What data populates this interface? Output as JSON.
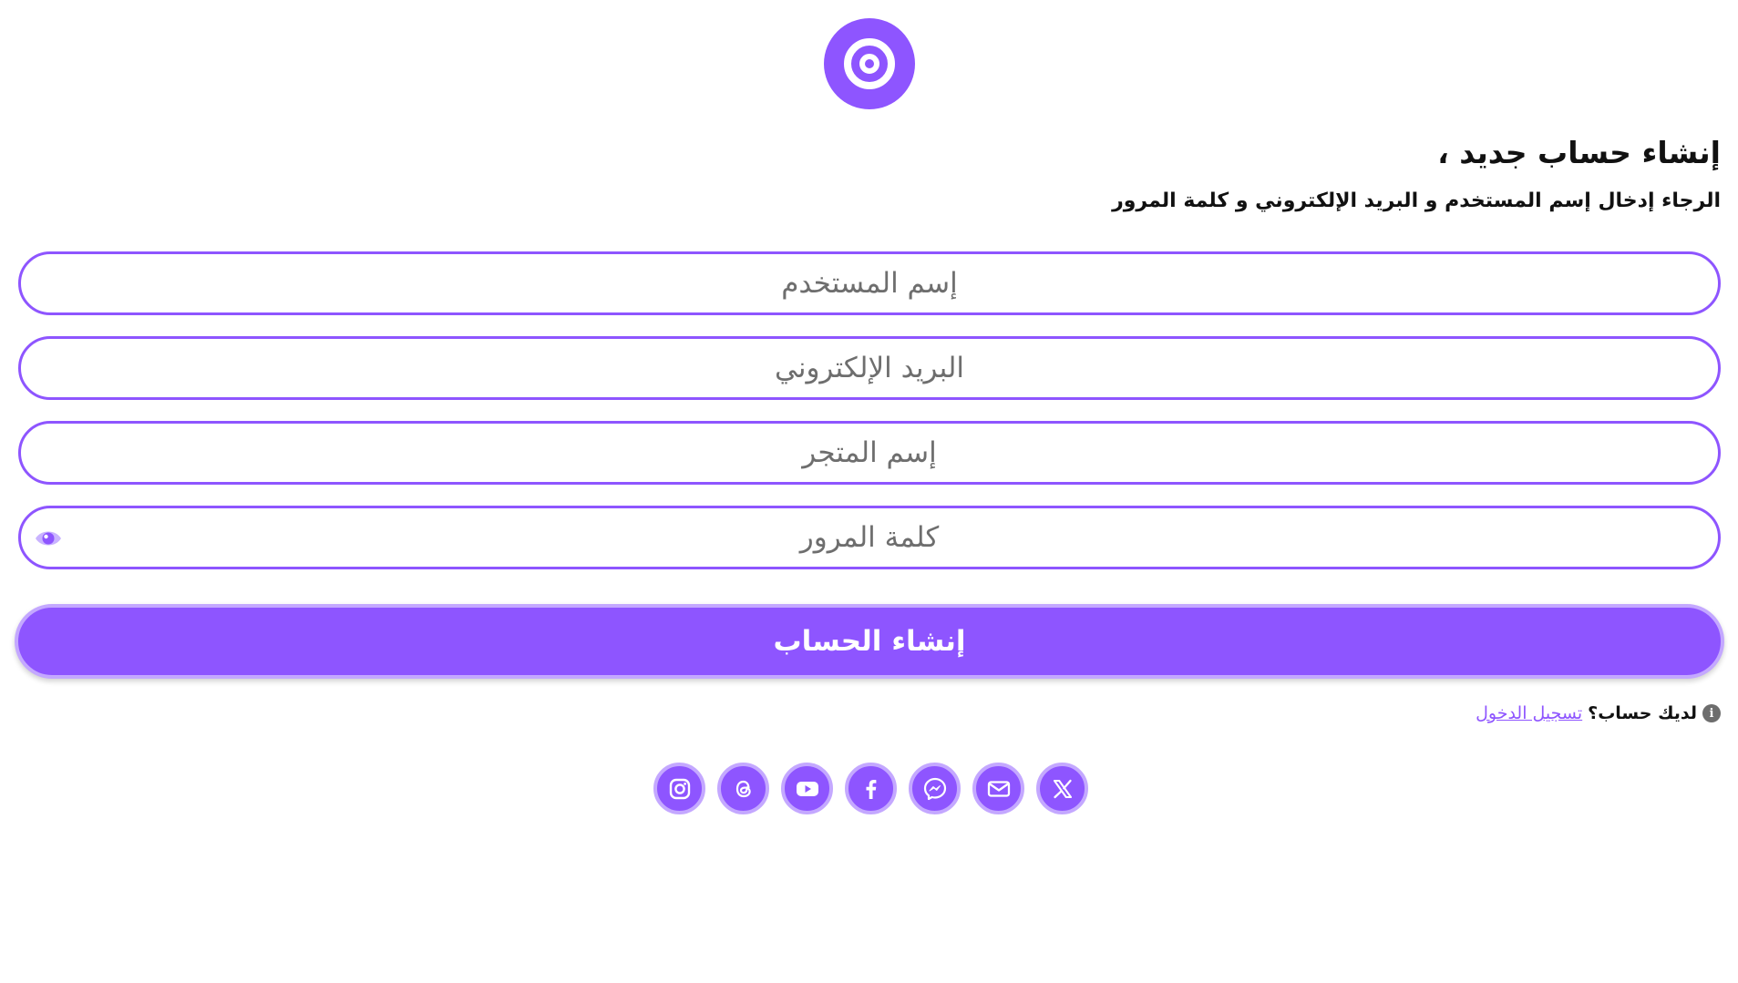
{
  "brand": {
    "logo_icon": "target-icon",
    "accent_color": "#8e55ff"
  },
  "form": {
    "heading": "إنشاء حساب جديد ،",
    "subheading": "الرجاء إدخال إسم المستخدم و البريد الإلكتروني و كلمة المرور",
    "username_placeholder": "إسم المستخدم",
    "email_placeholder": "البريد الإلكتروني",
    "store_placeholder": "إسم المتجر",
    "password_placeholder": "كلمة المرور",
    "password_toggle_icon": "eye-icon",
    "submit_label": "إنشاء الحساب"
  },
  "login_prompt": {
    "info_icon": "info-icon",
    "text": "لديك حساب؟",
    "link_label": "تسجيل الدخول"
  },
  "socials": [
    {
      "name": "instagram",
      "icon": "instagram-icon"
    },
    {
      "name": "threads",
      "icon": "threads-icon"
    },
    {
      "name": "youtube",
      "icon": "youtube-icon"
    },
    {
      "name": "facebook",
      "icon": "facebook-icon"
    },
    {
      "name": "messenger",
      "icon": "messenger-icon"
    },
    {
      "name": "email",
      "icon": "mail-icon"
    },
    {
      "name": "x",
      "icon": "x-icon"
    }
  ]
}
